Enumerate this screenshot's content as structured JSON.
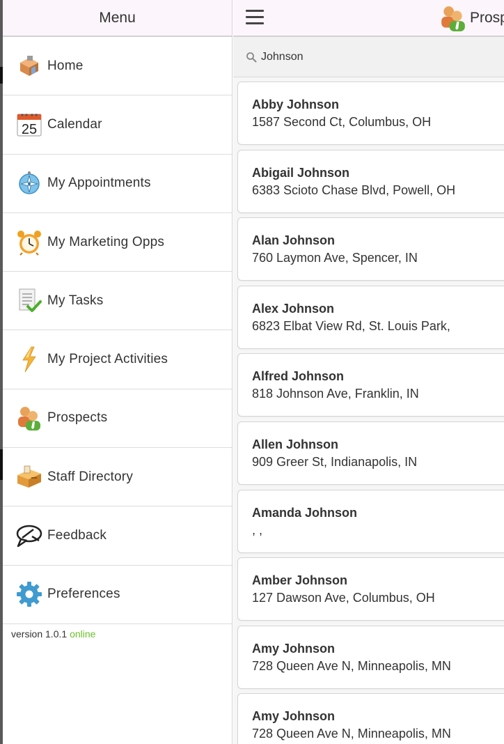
{
  "menu": {
    "title": "Menu",
    "items": [
      {
        "label": "Home",
        "icon": "home-icon"
      },
      {
        "label": "Calendar",
        "icon": "calendar-icon",
        "icon_text": "25"
      },
      {
        "label": "My Appointments",
        "icon": "compass-icon"
      },
      {
        "label": "My Marketing Opps",
        "icon": "alarm-clock-icon"
      },
      {
        "label": "My Tasks",
        "icon": "task-document-icon"
      },
      {
        "label": "My Project Activities",
        "icon": "lightning-icon"
      },
      {
        "label": "Prospects",
        "icon": "prospects-icon"
      },
      {
        "label": "Staff Directory",
        "icon": "desk-icon"
      },
      {
        "label": "Feedback",
        "icon": "speech-bubble-icon"
      },
      {
        "label": "Preferences",
        "icon": "gear-icon"
      }
    ],
    "version_label": "version 1.0.1",
    "status": "online",
    "status_color": "#6cbf2a"
  },
  "topbar": {
    "title": "Prosp",
    "icon": "prospects-icon"
  },
  "search": {
    "value": "Johnson",
    "icon": "search-icon"
  },
  "results": [
    {
      "name": "Abby Johnson",
      "address": "1587 Second Ct, Columbus, OH"
    },
    {
      "name": "Abigail Johnson",
      "address": "6383 Scioto Chase Blvd, Powell, OH"
    },
    {
      "name": "Alan Johnson",
      "address": "760 Laymon Ave, Spencer, IN"
    },
    {
      "name": "Alex Johnson",
      "address": "6823 Elbat View Rd, St. Louis Park,"
    },
    {
      "name": "Alfred Johnson",
      "address": "818 Johnson Ave, Franklin, IN"
    },
    {
      "name": "Allen Johnson",
      "address": "909 Greer St, Indianapolis, IN"
    },
    {
      "name": "Amanda Johnson",
      "address": ", ,"
    },
    {
      "name": "Amber Johnson",
      "address": "127 Dawson Ave, Columbus, OH"
    },
    {
      "name": "Amy Johnson",
      "address": "728 Queen Ave N, Minneapolis, MN"
    },
    {
      "name": "Amy Johnson",
      "address": "728 Queen Ave N, Minneapolis, MN"
    }
  ]
}
